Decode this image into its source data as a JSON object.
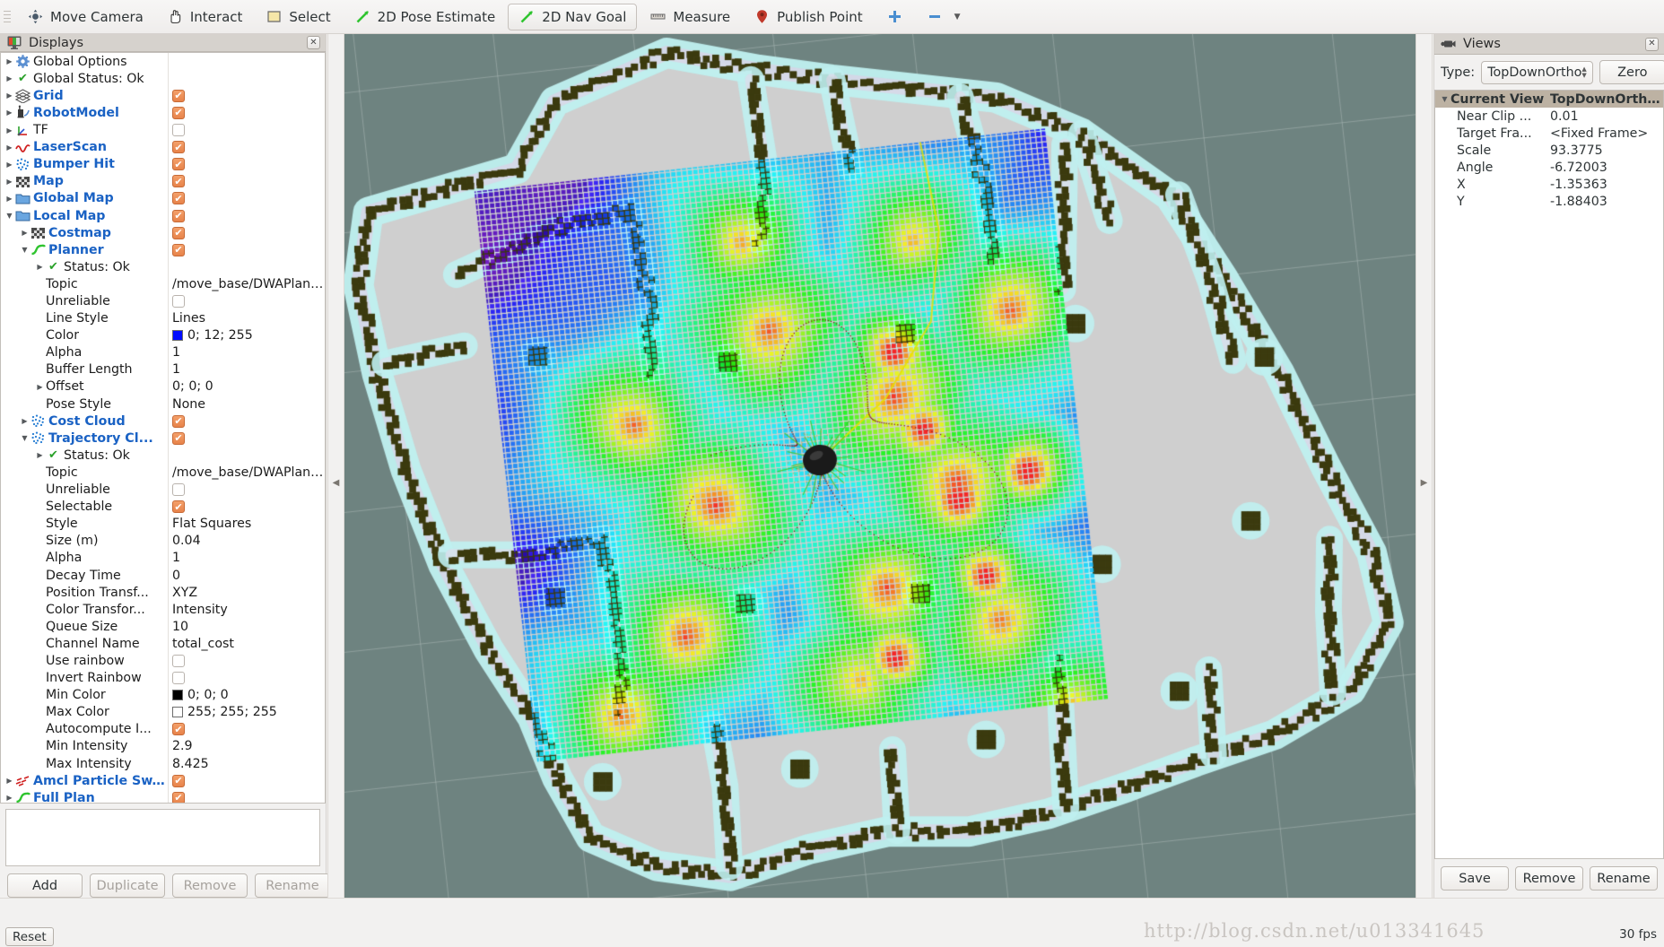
{
  "app": {
    "fps": "30 fps",
    "watermark": "http://blog.csdn.net/u013341645",
    "reset_label": "Reset"
  },
  "toolbar": {
    "items": [
      {
        "label": "Move Camera",
        "icon": "move-camera-icon",
        "checked": false
      },
      {
        "label": "Interact",
        "icon": "hand-icon",
        "checked": false
      },
      {
        "label": "Select",
        "icon": "select-rect-icon",
        "checked": false
      },
      {
        "label": "2D Pose Estimate",
        "icon": "pose-arrow-icon",
        "checked": false
      },
      {
        "label": "2D Nav Goal",
        "icon": "nav-goal-arrow-icon",
        "checked": true
      },
      {
        "label": "Measure",
        "icon": "ruler-icon",
        "checked": false
      },
      {
        "label": "Publish Point",
        "icon": "map-pin-icon",
        "checked": false
      }
    ],
    "add_tool_label": "+",
    "more_label": "—"
  },
  "displays": {
    "title": "Displays",
    "icon": "displays-icon",
    "close_label": "✕",
    "buttons": [
      {
        "label": "Add",
        "enabled": true
      },
      {
        "label": "Duplicate",
        "enabled": false
      },
      {
        "label": "Remove",
        "enabled": false
      },
      {
        "label": "Rename",
        "enabled": false
      }
    ],
    "rows": [
      {
        "indent": 0,
        "arrow": "right",
        "icon": "gear-icon",
        "label": "Global Options",
        "style": "plain",
        "value_type": "none"
      },
      {
        "indent": 0,
        "arrow": "right",
        "icon": "check-icon",
        "label": "Global Status: Ok",
        "style": "plain",
        "value_type": "none"
      },
      {
        "indent": 0,
        "arrow": "right",
        "icon": "grid-icon",
        "label": "Grid",
        "style": "bold",
        "value_type": "checkbox",
        "checked": true
      },
      {
        "indent": 0,
        "arrow": "right",
        "icon": "robot-icon",
        "label": "RobotModel",
        "style": "bold",
        "value_type": "checkbox",
        "checked": true
      },
      {
        "indent": 0,
        "arrow": "right",
        "icon": "tf-icon",
        "label": "TF",
        "style": "plain",
        "value_type": "checkbox",
        "checked": false
      },
      {
        "indent": 0,
        "arrow": "right",
        "icon": "laserscan-icon",
        "label": "LaserScan",
        "style": "bold",
        "value_type": "checkbox",
        "checked": true
      },
      {
        "indent": 0,
        "arrow": "right",
        "icon": "pointcloud-icon",
        "label": "Bumper Hit",
        "style": "bold",
        "value_type": "checkbox",
        "checked": true
      },
      {
        "indent": 0,
        "arrow": "right",
        "icon": "map-icon",
        "label": "Map",
        "style": "bold",
        "value_type": "checkbox",
        "checked": true
      },
      {
        "indent": 0,
        "arrow": "right",
        "icon": "folder-icon",
        "label": "Global Map",
        "style": "bold",
        "value_type": "checkbox",
        "checked": true
      },
      {
        "indent": 0,
        "arrow": "down",
        "icon": "folder-icon",
        "label": "Local Map",
        "style": "bold",
        "value_type": "checkbox",
        "checked": true
      },
      {
        "indent": 1,
        "arrow": "right",
        "icon": "map-icon",
        "label": "Costmap",
        "style": "bold",
        "value_type": "checkbox",
        "checked": true
      },
      {
        "indent": 1,
        "arrow": "down",
        "icon": "path-icon",
        "label": "Planner",
        "style": "bold",
        "value_type": "checkbox",
        "checked": true
      },
      {
        "indent": 2,
        "arrow": "right",
        "icon": "check-icon",
        "label": "Status: Ok",
        "style": "plain",
        "value_type": "none"
      },
      {
        "indent": 2,
        "arrow": "none",
        "icon": "none",
        "label": "Topic",
        "style": "prop",
        "value_type": "text",
        "value": "/move_base/DWAPlann..."
      },
      {
        "indent": 2,
        "arrow": "none",
        "icon": "none",
        "label": "Unreliable",
        "style": "prop",
        "value_type": "checkbox",
        "checked": false
      },
      {
        "indent": 2,
        "arrow": "none",
        "icon": "none",
        "label": "Line Style",
        "style": "prop",
        "value_type": "text",
        "value": "Lines"
      },
      {
        "indent": 2,
        "arrow": "none",
        "icon": "none",
        "label": "Color",
        "style": "prop",
        "value_type": "color",
        "value": "0; 12; 255",
        "color": "#000cff"
      },
      {
        "indent": 2,
        "arrow": "none",
        "icon": "none",
        "label": "Alpha",
        "style": "prop",
        "value_type": "text",
        "value": "1"
      },
      {
        "indent": 2,
        "arrow": "none",
        "icon": "none",
        "label": "Buffer Length",
        "style": "prop",
        "value_type": "text",
        "value": "1"
      },
      {
        "indent": 2,
        "arrow": "right",
        "icon": "none",
        "label": "Offset",
        "style": "prop",
        "value_type": "text",
        "value": "0; 0; 0"
      },
      {
        "indent": 2,
        "arrow": "none",
        "icon": "none",
        "label": "Pose Style",
        "style": "prop",
        "value_type": "text",
        "value": "None"
      },
      {
        "indent": 1,
        "arrow": "right",
        "icon": "pointcloud-icon",
        "label": "Cost Cloud",
        "style": "bold",
        "value_type": "checkbox",
        "checked": true
      },
      {
        "indent": 1,
        "arrow": "down",
        "icon": "pointcloud-icon",
        "label": "Trajectory Cl...",
        "style": "bold",
        "value_type": "checkbox",
        "checked": true
      },
      {
        "indent": 2,
        "arrow": "right",
        "icon": "check-icon",
        "label": "Status: Ok",
        "style": "plain",
        "value_type": "none"
      },
      {
        "indent": 2,
        "arrow": "none",
        "icon": "none",
        "label": "Topic",
        "style": "prop",
        "value_type": "text",
        "value": "/move_base/DWAPlann..."
      },
      {
        "indent": 2,
        "arrow": "none",
        "icon": "none",
        "label": "Unreliable",
        "style": "prop",
        "value_type": "checkbox",
        "checked": false
      },
      {
        "indent": 2,
        "arrow": "none",
        "icon": "none",
        "label": "Selectable",
        "style": "prop",
        "value_type": "checkbox",
        "checked": true
      },
      {
        "indent": 2,
        "arrow": "none",
        "icon": "none",
        "label": "Style",
        "style": "prop",
        "value_type": "text",
        "value": "Flat Squares"
      },
      {
        "indent": 2,
        "arrow": "none",
        "icon": "none",
        "label": "Size (m)",
        "style": "prop",
        "value_type": "text",
        "value": "0.04"
      },
      {
        "indent": 2,
        "arrow": "none",
        "icon": "none",
        "label": "Alpha",
        "style": "prop",
        "value_type": "text",
        "value": "1"
      },
      {
        "indent": 2,
        "arrow": "none",
        "icon": "none",
        "label": "Decay Time",
        "style": "prop",
        "value_type": "text",
        "value": "0"
      },
      {
        "indent": 2,
        "arrow": "none",
        "icon": "none",
        "label": "Position Transf...",
        "style": "prop",
        "value_type": "text",
        "value": "XYZ"
      },
      {
        "indent": 2,
        "arrow": "none",
        "icon": "none",
        "label": "Color Transfor...",
        "style": "prop",
        "value_type": "text",
        "value": "Intensity"
      },
      {
        "indent": 2,
        "arrow": "none",
        "icon": "none",
        "label": "Queue Size",
        "style": "prop",
        "value_type": "text",
        "value": "10"
      },
      {
        "indent": 2,
        "arrow": "none",
        "icon": "none",
        "label": "Channel Name",
        "style": "prop",
        "value_type": "text",
        "value": "total_cost"
      },
      {
        "indent": 2,
        "arrow": "none",
        "icon": "none",
        "label": "Use rainbow",
        "style": "prop",
        "value_type": "checkbox",
        "checked": false
      },
      {
        "indent": 2,
        "arrow": "none",
        "icon": "none",
        "label": "Invert Rainbow",
        "style": "prop",
        "value_type": "checkbox",
        "checked": false
      },
      {
        "indent": 2,
        "arrow": "none",
        "icon": "none",
        "label": "Min Color",
        "style": "prop",
        "value_type": "color",
        "value": "0; 0; 0",
        "color": "#000000"
      },
      {
        "indent": 2,
        "arrow": "none",
        "icon": "none",
        "label": "Max Color",
        "style": "prop",
        "value_type": "color",
        "value": "255; 255; 255",
        "color": "#ffffff"
      },
      {
        "indent": 2,
        "arrow": "none",
        "icon": "none",
        "label": "Autocompute I...",
        "style": "prop",
        "value_type": "checkbox",
        "checked": true
      },
      {
        "indent": 2,
        "arrow": "none",
        "icon": "none",
        "label": "Min Intensity",
        "style": "prop",
        "value_type": "text",
        "value": "2.9"
      },
      {
        "indent": 2,
        "arrow": "none",
        "icon": "none",
        "label": "Max Intensity",
        "style": "prop",
        "value_type": "text",
        "value": "8.425"
      },
      {
        "indent": 0,
        "arrow": "right",
        "icon": "posearray-icon",
        "label": "Amcl Particle Sw...",
        "style": "bold",
        "value_type": "checkbox",
        "checked": true
      },
      {
        "indent": 0,
        "arrow": "right",
        "icon": "path-icon",
        "label": "Full Plan",
        "style": "bold",
        "value_type": "checkbox",
        "checked": true
      }
    ]
  },
  "views": {
    "title": "Views",
    "icon": "camera-icon",
    "close_label": "✕",
    "type_label": "Type:",
    "type_value": "TopDownOrtho",
    "zero_label": "Zero",
    "tree": [
      {
        "arrow": "down",
        "name": "Current View",
        "value": "TopDownOrtho ...",
        "header": true
      },
      {
        "arrow": "none",
        "name": "Near Clip ...",
        "value": "0.01",
        "header": false
      },
      {
        "arrow": "none",
        "name": "Target Fra...",
        "value": "<Fixed Frame>",
        "header": false
      },
      {
        "arrow": "none",
        "name": "Scale",
        "value": "93.3775",
        "header": false
      },
      {
        "arrow": "none",
        "name": "Angle",
        "value": "-6.72003",
        "header": false
      },
      {
        "arrow": "none",
        "name": "X",
        "value": "-1.35363",
        "header": false
      },
      {
        "arrow": "none",
        "name": "Y",
        "value": "-1.88403",
        "header": false
      }
    ],
    "buttons": [
      {
        "label": "Save"
      },
      {
        "label": "Remove"
      },
      {
        "label": "Rename"
      }
    ]
  },
  "render_view": {
    "background_color": "#6e8380",
    "map_free_color": "#cfcfcf",
    "map_wall_color": "#3b3a0e",
    "inflation_color": "#bff0ef",
    "grid_color": "#b7c4c0",
    "robot_color": "#1a1a1a",
    "description": "Top-down orthographic RViz 3D view showing an occupancy grid map with inflated obstacles, a local costmap rendered as a rainbow-colored trajectory cloud, and the robot at the center."
  }
}
